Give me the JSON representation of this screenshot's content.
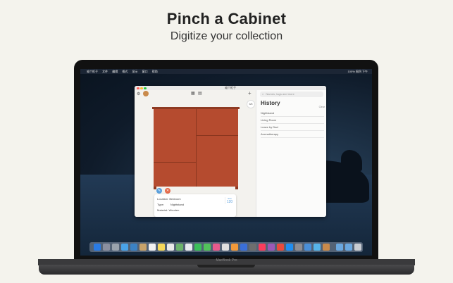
{
  "headline": {
    "title": "Pinch a Cabinet",
    "subtitle": "Digitize your collection"
  },
  "menubar": {
    "items": [
      "喵个柜子",
      "文件",
      "编辑",
      "格式",
      "显示",
      "窗口",
      "帮助"
    ],
    "status": "100% 周四 下午"
  },
  "app": {
    "window_title": "喵个柜子",
    "info_card": {
      "location_label": "Location:",
      "location_value": "Bedroom",
      "type_label": "Type:",
      "type_value": "Nightstand",
      "material_label": "Material:",
      "material_value": "Wooden",
      "size_label": "Size",
      "size_value": "120"
    },
    "sidebar": {
      "search_placeholder": "Names, tags and more",
      "count": "6/8",
      "history_title": "History",
      "clear_label": "Clear",
      "history_items": [
        "Nightstand",
        "Living Room",
        "Leave by Dad",
        "Aromatherapy"
      ]
    }
  },
  "device": {
    "name": "MacBook Pro"
  },
  "colors": {
    "cabinet": "#b54b2f",
    "accent_blue": "#5aa0dc",
    "accent_orange": "#e46a4a"
  }
}
